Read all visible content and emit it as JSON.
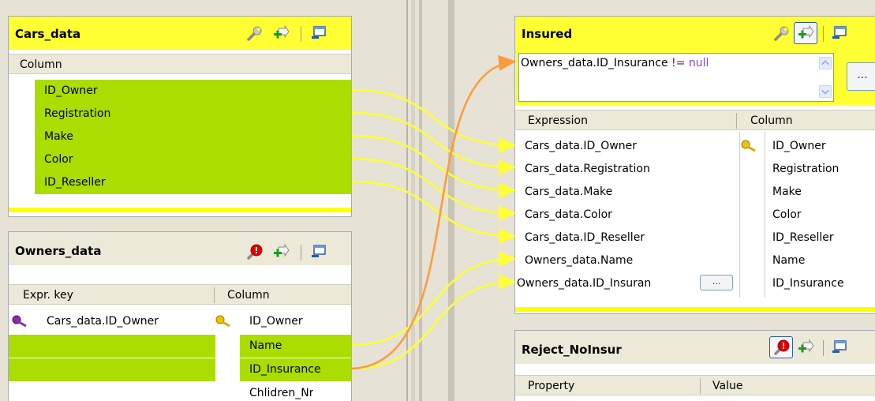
{
  "cars_panel": {
    "title": "Cars_data",
    "column_header": "Column",
    "rows": [
      "ID_Owner",
      "Registration",
      "Make",
      "Color",
      "ID_Reseller"
    ]
  },
  "owners_panel": {
    "title": "Owners_data",
    "expr_header": "Expr. key",
    "column_header": "Column",
    "rows": [
      {
        "expr": "Cars_data.ID_Owner",
        "column": "ID_Owner"
      },
      {
        "expr": "",
        "column": "Name"
      },
      {
        "expr": "",
        "column": "ID_Insurance"
      },
      {
        "expr": "",
        "column": "Chlidren_Nr"
      }
    ]
  },
  "insured_panel": {
    "title": "Insured",
    "filter": {
      "prefix": "Owners_data.ID_Insurance ",
      "operator": "!=",
      "value": " null"
    },
    "filter_button": "...",
    "expression_header": "Expression",
    "column_header": "Column",
    "rows": [
      {
        "expr": "Cars_data.ID_Owner",
        "column": "ID_Owner"
      },
      {
        "expr": "Cars_data.Registration",
        "column": "Registration"
      },
      {
        "expr": "Cars_data.Make",
        "column": "Make"
      },
      {
        "expr": "Cars_data.Color",
        "column": "Color"
      },
      {
        "expr": "Cars_data.ID_Reseller",
        "column": "ID_Reseller"
      },
      {
        "expr": "Owners_data.Name",
        "column": "Name"
      },
      {
        "expr": "Owners_data.ID_Insuran",
        "column": "ID_Insurance"
      }
    ],
    "row_button": "..."
  },
  "reject_panel": {
    "title": "Reject_NoInsur",
    "property_header": "Property",
    "value_header": "Value"
  },
  "icons": {
    "wrench": "wrench-icon",
    "add_input": "add-arrow-icon",
    "minimize": "minimize-window-icon",
    "key_gold": "key-icon",
    "key_purple": "join-key-icon",
    "error_badge": "error-badge-icon"
  },
  "colors": {
    "title_yellow": "#ffff33",
    "row_green": "#aadd00",
    "link_yellow": "#ffff33",
    "link_orange": "#ff9933"
  }
}
